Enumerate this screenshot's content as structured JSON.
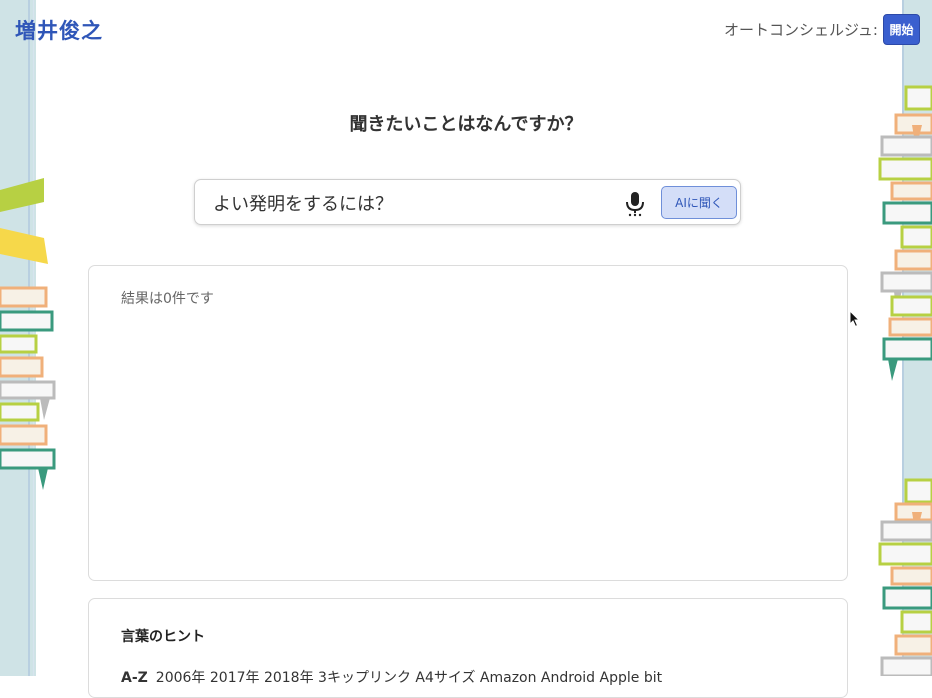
{
  "header": {
    "logo": "増井俊之",
    "concierge_label": "オートコンシェルジュ:",
    "start_button": "開始"
  },
  "main": {
    "question_title": "聞きたいことはなんですか？",
    "search": {
      "value": "よい発明をするには？",
      "ask_button": "AIに聞く"
    },
    "results": {
      "status": "結果は0件です"
    },
    "hints": {
      "title": "言葉のヒント",
      "lead": "A-Z",
      "words": "2006年  2017年  2018年  3キップリンク  A4サイズ  Amazon  Android  Apple  bit"
    }
  },
  "icons": {
    "microphone": "microphone-icon",
    "cursor": "mouse-pointer-icon"
  },
  "colors": {
    "accent": "#2f56b8",
    "button_bg": "#3a5fcf",
    "ask_bg": "#d4def8"
  }
}
